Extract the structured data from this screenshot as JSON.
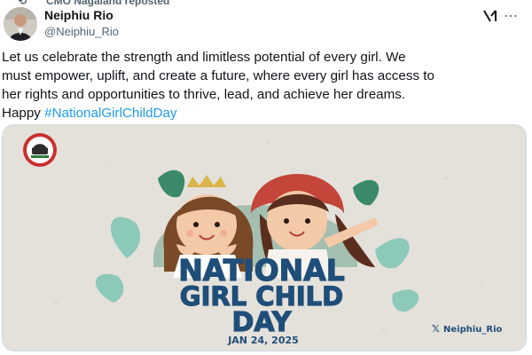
{
  "repost": {
    "text": "CMO Nagaland reposted",
    "icon": "repost-icon"
  },
  "author": {
    "name": "Neiphiu Rio",
    "handle": "@Neiphiu_Rio"
  },
  "actions": {
    "grok_icon": "grok-icon",
    "more_icon": "more-icon"
  },
  "tweet": {
    "lines": [
      "Let us celebrate the strength and limitless potential of every girl. We",
      "must empower, uplift, and create a future, where every girl has access to",
      "her rights and opportunities to thrive, lead, and achieve her dreams."
    ],
    "prefix": "Happy ",
    "hashtag": "#NationalGirlChildDay"
  },
  "poster": {
    "title_line1": "NATIONAL",
    "title_line2": "GIRL CHILD",
    "title_line3": "DAY",
    "date": "JAN 24, 2025",
    "watermark": "Neiphiu_Rio",
    "colors": {
      "background": "#e4e1db",
      "title": "#1f4e79",
      "leaf": "#8dc9b8",
      "hair_brown": "#7a4a28",
      "hat_red": "#c4453a",
      "crown": "#d9b548"
    }
  },
  "colors": {
    "accent": "#1d9bf0",
    "text": "#0f1419",
    "muted": "#536471",
    "border": "#cfd9de"
  }
}
